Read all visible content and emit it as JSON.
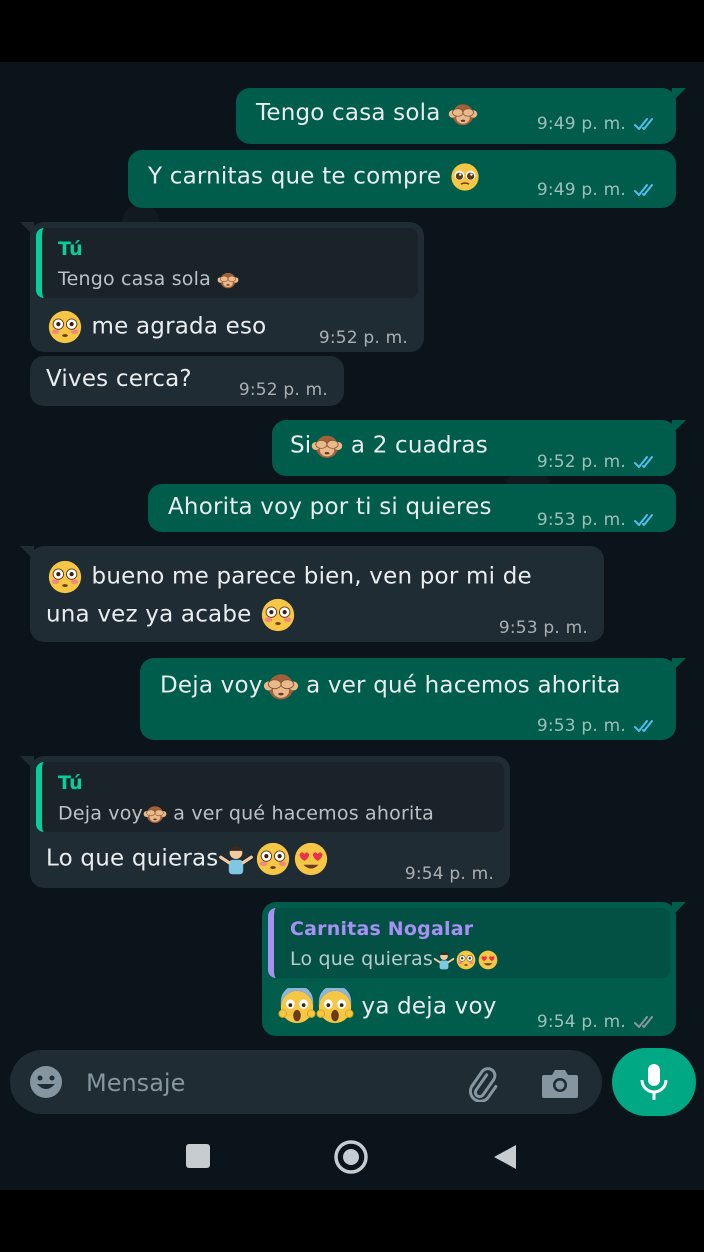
{
  "colors": {
    "chat_background": "#0b141a",
    "outgoing_bubble": "#005c4b",
    "incoming_bubble": "#202c33",
    "accent_green": "#00a884",
    "read_ticks": "#53bdeb",
    "quote_self_name": "#06cf9c",
    "quote_contact_name": "#a791f5"
  },
  "messages": [
    {
      "direction": "out",
      "text": "Tengo casa sola",
      "emoji": "see-no-evil-monkey",
      "time": "9:49 p. m.",
      "status": "read"
    },
    {
      "direction": "out",
      "text": "Y carnitas que te compre",
      "emoji": "pleading-face",
      "time": "9:49 p. m.",
      "status": "read"
    },
    {
      "direction": "in",
      "quote": {
        "author": "Tú",
        "text": "Tengo casa sola"
      },
      "text": "me agrada eso",
      "emoji": "flushed-face",
      "time": "9:52 p. m."
    },
    {
      "direction": "in",
      "text": "Vives cerca?",
      "time": "9:52 p. m."
    },
    {
      "direction": "out",
      "text_before": "Si",
      "text": "a 2 cuadras",
      "emoji": "see-no-evil-monkey",
      "time": "9:52 p. m.",
      "status": "read"
    },
    {
      "direction": "out",
      "text": "Ahorita voy por ti si quieres",
      "time": "9:53 p. m.",
      "status": "read"
    },
    {
      "direction": "in",
      "line1": "bueno me parece bien, ven por mi de",
      "line2": "una vez ya acabe",
      "emoji": "flushed-face",
      "time": "9:53 p. m."
    },
    {
      "direction": "out",
      "text_before": "Deja voy",
      "text": "a ver qué hacemos ahorita",
      "emoji": "see-no-evil-monkey",
      "time": "9:53 p. m.",
      "status": "read"
    },
    {
      "direction": "in",
      "quote": {
        "author": "Tú",
        "text_before": "Deja voy",
        "text": "a ver qué hacemos ahorita"
      },
      "text": "Lo que quieras",
      "emoji": "shrug-flushed-heart-eyes",
      "time": "9:54 p. m."
    },
    {
      "direction": "out",
      "quote": {
        "author": "Carnitas Nogalar",
        "text": "Lo que quieras"
      },
      "text": "ya deja voy",
      "emoji": "screaming-face",
      "time": "9:54 p. m.",
      "status": "delivered"
    }
  ],
  "composer": {
    "placeholder": "Mensaje",
    "emoji_icon": "emoji-icon",
    "attach_icon": "paperclip-icon",
    "camera_icon": "camera-icon",
    "mic_icon": "microphone-icon"
  },
  "navbar": {
    "recents_icon": "square-icon",
    "home_icon": "circle-icon",
    "back_icon": "triangle-back-icon"
  }
}
